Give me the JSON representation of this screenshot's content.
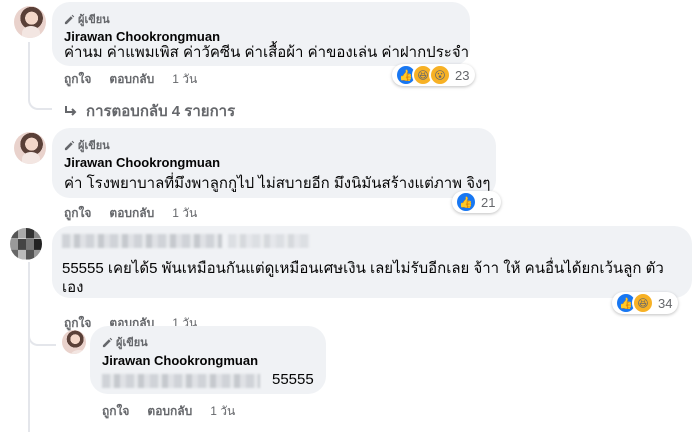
{
  "comments": [
    {
      "badge": "ผู้เขียน",
      "author": "Jirawan Chookrongmuan",
      "text": "ค่านม ค่าแพมเพิส ค่าวัคซีน ค่าเสื้อผ้า ค่าของเล่น ค่าฝากประจำ",
      "like": "ถูกใจ",
      "reply": "ตอบกลับ",
      "time": "1 วัน",
      "reaction_count": "23"
    },
    {
      "badge": "ผู้เขียน",
      "author": "Jirawan Chookrongmuan",
      "text": "ค่า โรงพยาบาลที่มึงพาลูกกูไป ไม่สบายอีก มึงนิมันสร้างแต่ภาพ จิงๆ",
      "like": "ถูกใจ",
      "reply": "ตอบกลับ",
      "time": "1 วัน",
      "reaction_count": "21"
    },
    {
      "text_line1": "55555 เคยได้5 พันเหมือนกันแต่ดูเหมือนเศษเงิน เลยไม่รับอีกเลย จ้าา ให้ คนอื่นได้ยกเว้นลูก ตัว",
      "text_line2": "เอง",
      "like": "ถูกใจ",
      "reply": "ตอบกลับ",
      "time": "1 วัน",
      "reaction_count": "34"
    },
    {
      "badge": "ผู้เขียน",
      "author": "Jirawan Chookrongmuan",
      "text_tail": "55555",
      "like": "ถูกใจ",
      "reply": "ตอบกลับ",
      "time": "1 วัน"
    }
  ],
  "replies_link": "การตอบกลับ 4 รายการ",
  "colors": {
    "bubble": "#f0f2f5",
    "meta": "#65676b",
    "like_blue": "#1877f2",
    "emoji_yellow": "#f7b125"
  }
}
